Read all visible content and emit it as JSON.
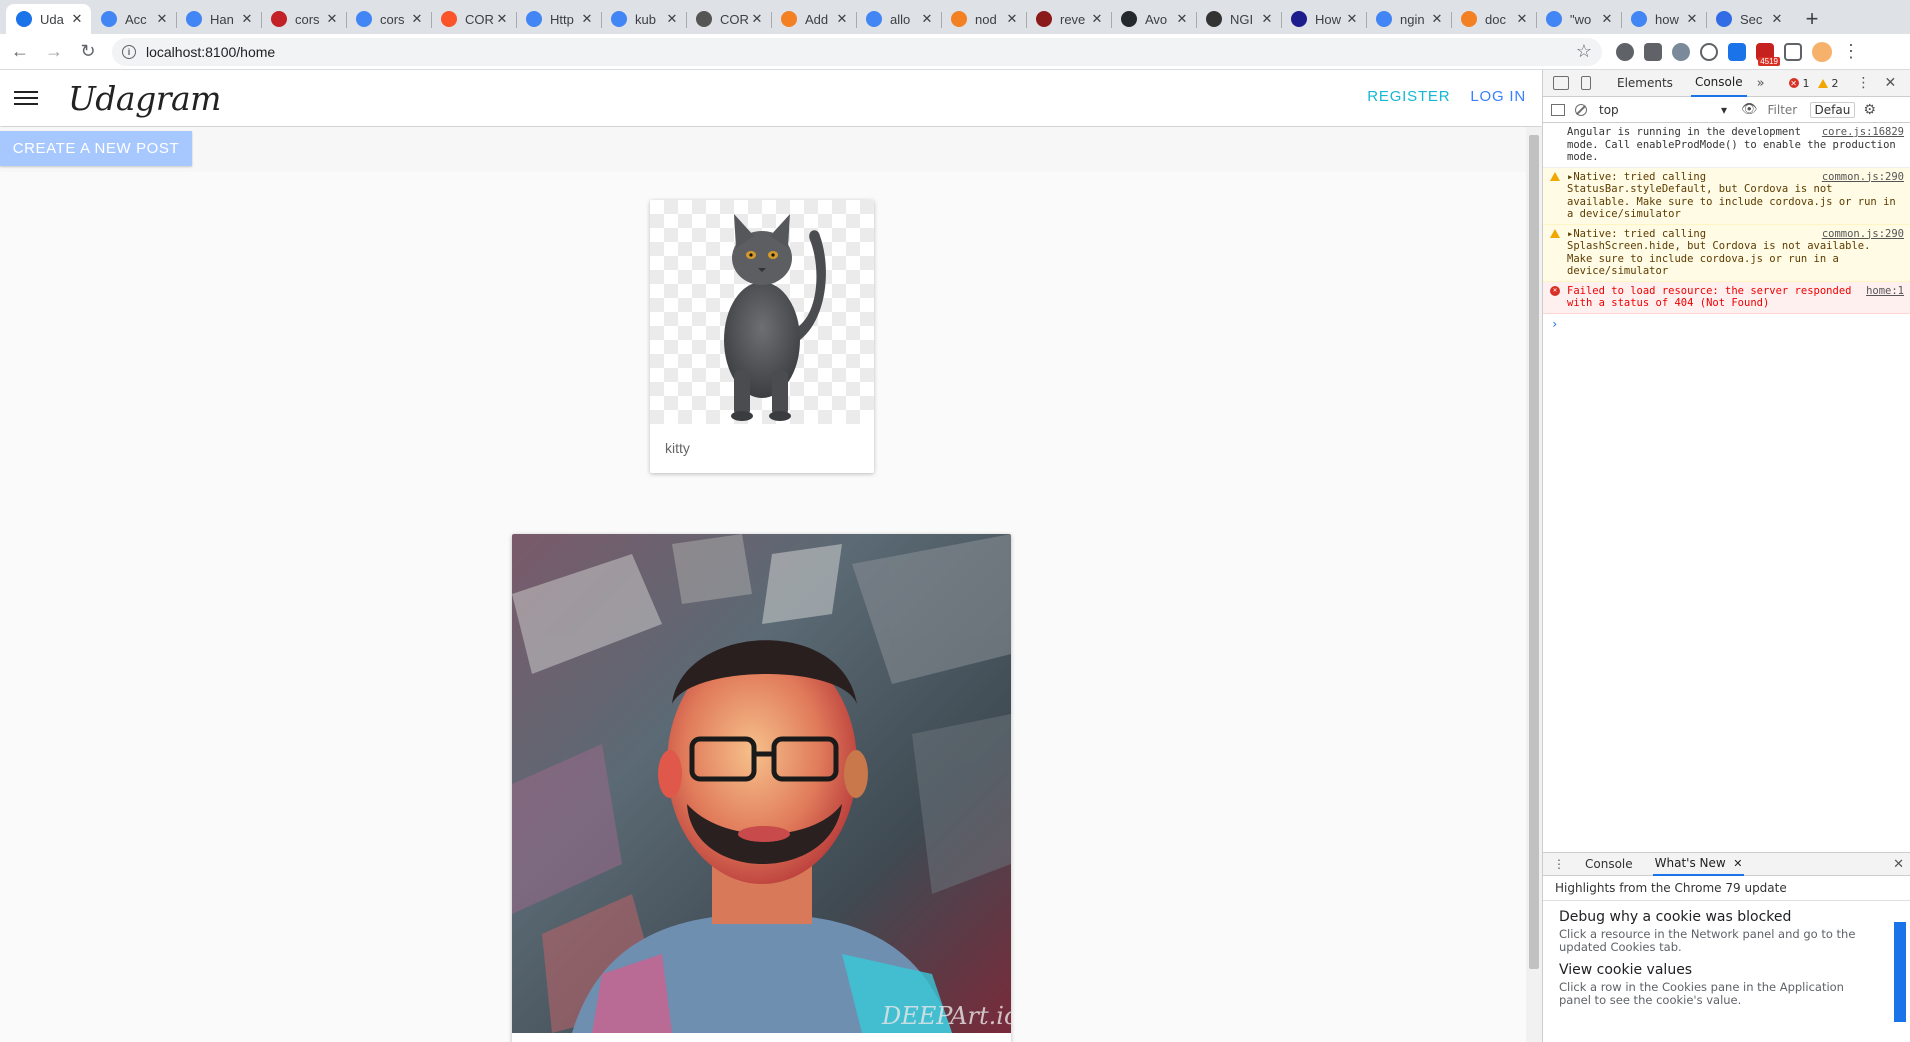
{
  "browser": {
    "tabs": [
      {
        "label": "Uda",
        "favicon": "chrome-icon",
        "color": "#1a73e8",
        "active": true
      },
      {
        "label": "Acc",
        "favicon": "google-icon",
        "color": "#4285f4"
      },
      {
        "label": "Han",
        "favicon": "circle-g-icon",
        "color": "#4285f4"
      },
      {
        "label": "cors",
        "favicon": "npm-icon",
        "color": "#c12127"
      },
      {
        "label": "cors",
        "favicon": "google-icon",
        "color": "#4285f4"
      },
      {
        "label": "COR",
        "favicon": "brave-icon",
        "color": "#fb542b"
      },
      {
        "label": "Http",
        "favicon": "google-icon",
        "color": "#4285f4"
      },
      {
        "label": "kub",
        "favicon": "google-icon",
        "color": "#4285f4"
      },
      {
        "label": "COR",
        "favicon": "image-icon",
        "color": "#555555"
      },
      {
        "label": "Add",
        "favicon": "stackoverflow-icon",
        "color": "#f48024"
      },
      {
        "label": "allo",
        "favicon": "google-icon",
        "color": "#4285f4"
      },
      {
        "label": "nod",
        "favicon": "stackoverflow-icon",
        "color": "#f48024"
      },
      {
        "label": "reve",
        "favicon": "flag-icon",
        "color": "#8b1a1a"
      },
      {
        "label": "Avo",
        "favicon": "github-icon",
        "color": "#24292e"
      },
      {
        "label": "NGI",
        "favicon": "cloud-icon",
        "color": "#333333"
      },
      {
        "label": "How",
        "favicon": "b-icon",
        "color": "#1c1c8c"
      },
      {
        "label": "ngin",
        "favicon": "google-icon",
        "color": "#4285f4"
      },
      {
        "label": "doc",
        "favicon": "stackoverflow-icon",
        "color": "#f48024"
      },
      {
        "label": "\"wo",
        "favicon": "google-icon",
        "color": "#4285f4"
      },
      {
        "label": "how",
        "favicon": "google-icon",
        "color": "#4285f4"
      },
      {
        "label": "Sec",
        "favicon": "kubernetes-icon",
        "color": "#326ce5"
      }
    ],
    "new_tab": "+",
    "url": "localhost:8100/home",
    "ext_badge": "4519"
  },
  "app": {
    "brand": "Udagram",
    "register": "REGISTER",
    "login": "LOG IN",
    "register_color": "#14b8d4",
    "login_color": "#3880ff",
    "create_post": "CREATE A NEW POST",
    "posts": [
      {
        "caption": "kitty",
        "image": "gray-cat-on-transparent-background"
      },
      {
        "caption": "",
        "image": "stylized-painted-portrait-of-man-with-glasses"
      }
    ],
    "watermark": "DEEPArt.io"
  },
  "devtools": {
    "tabs": {
      "elements": "Elements",
      "console": "Console",
      "more": "»"
    },
    "error_count": "1",
    "warning_count": "2",
    "context": "top",
    "filter_placeholder": "Filter",
    "levels": "Defau",
    "messages": [
      {
        "level": "info",
        "text": "Angular is running in the development mode. Call enableProdMode() to enable the production mode.",
        "source": "core.js:16829"
      },
      {
        "level": "warn",
        "text": "▸Native: tried calling StatusBar.styleDefault, but Cordova is not available. Make sure to include cordova.js or run in a device/simulator",
        "source": "common.js:290"
      },
      {
        "level": "warn",
        "text": "▸Native: tried calling SplashScreen.hide, but Cordova is not available. Make sure to include cordova.js or run in a device/simulator",
        "source": "common.js:290"
      },
      {
        "level": "error",
        "text": "Failed to load resource: the server responded with a status of 404 (Not Found)",
        "source": "home:1"
      }
    ],
    "prompt": "›",
    "drawer": {
      "console_tab": "Console",
      "whats_new_tab": "What's New",
      "highlights": "Highlights from the Chrome 79 update",
      "items": [
        {
          "title": "Debug why a cookie was blocked",
          "desc": "Click a resource in the Network panel and go to the updated Cookies tab."
        },
        {
          "title": "View cookie values",
          "desc": "Click a row in the Cookies pane in the Application panel to see the cookie's value."
        }
      ]
    }
  }
}
